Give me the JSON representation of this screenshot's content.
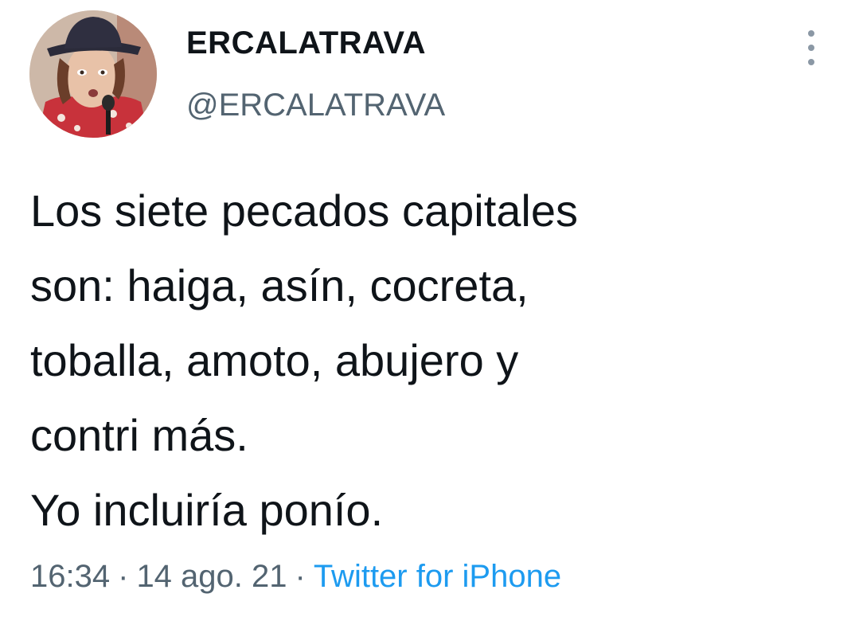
{
  "user": {
    "display_name": "ERCALATRAVA",
    "handle": "@ERCALATRAVA",
    "avatar_icon": "profile-photo"
  },
  "menu": {
    "icon": "more-vertical-icon"
  },
  "tweet": {
    "lines": [
      "Los siete pecados capitales",
      "son: haiga, asín, cocreta,",
      "toballa, amoto, abujero y",
      "contri más.",
      "Yo incluiría ponío."
    ]
  },
  "meta": {
    "time": "16:34",
    "separator": "·",
    "date": "14 ago. 21",
    "source": "Twitter for iPhone"
  },
  "colors": {
    "text": "#0f1419",
    "secondary": "#536471",
    "link": "#1d9bf0",
    "background": "#ffffff"
  }
}
